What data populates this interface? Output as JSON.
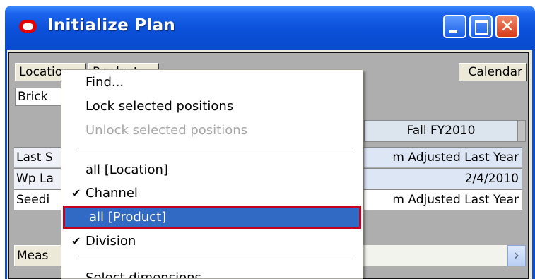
{
  "window": {
    "title": "Initialize Plan",
    "caption": {
      "close_glyph": "✕"
    }
  },
  "toolbar": {
    "location_label": "Location",
    "product_label": "Product",
    "calendar_label": "Calendar"
  },
  "brick_label": "Brick",
  "grid": {
    "column_header": "Fall FY2010",
    "rows": [
      {
        "label": "Last S",
        "value": "m Adjusted Last Year"
      },
      {
        "label": "Wp La",
        "value": "2/4/2010"
      },
      {
        "label": "Seedi",
        "value": "m Adjusted Last Year"
      }
    ]
  },
  "measures_label": "Meas",
  "scroll_arrow": "›",
  "context_menu": {
    "check_glyph": "✔",
    "items": [
      {
        "label": "Find..."
      },
      {
        "label": "Lock selected positions"
      },
      {
        "label": "Unlock selected positions",
        "disabled": true
      },
      {
        "label": "all [Location]"
      },
      {
        "label": "Channel",
        "checked": true
      },
      {
        "label": "all [Product]",
        "selected": true
      },
      {
        "label": "Division",
        "checked": true
      },
      {
        "label": "Select dimensions"
      }
    ]
  },
  "colors": {
    "titlebar": "#0a50d8",
    "selection": "#316ac5",
    "selection_border": "#c8001f",
    "column_header_bg": "#dce4ee"
  }
}
